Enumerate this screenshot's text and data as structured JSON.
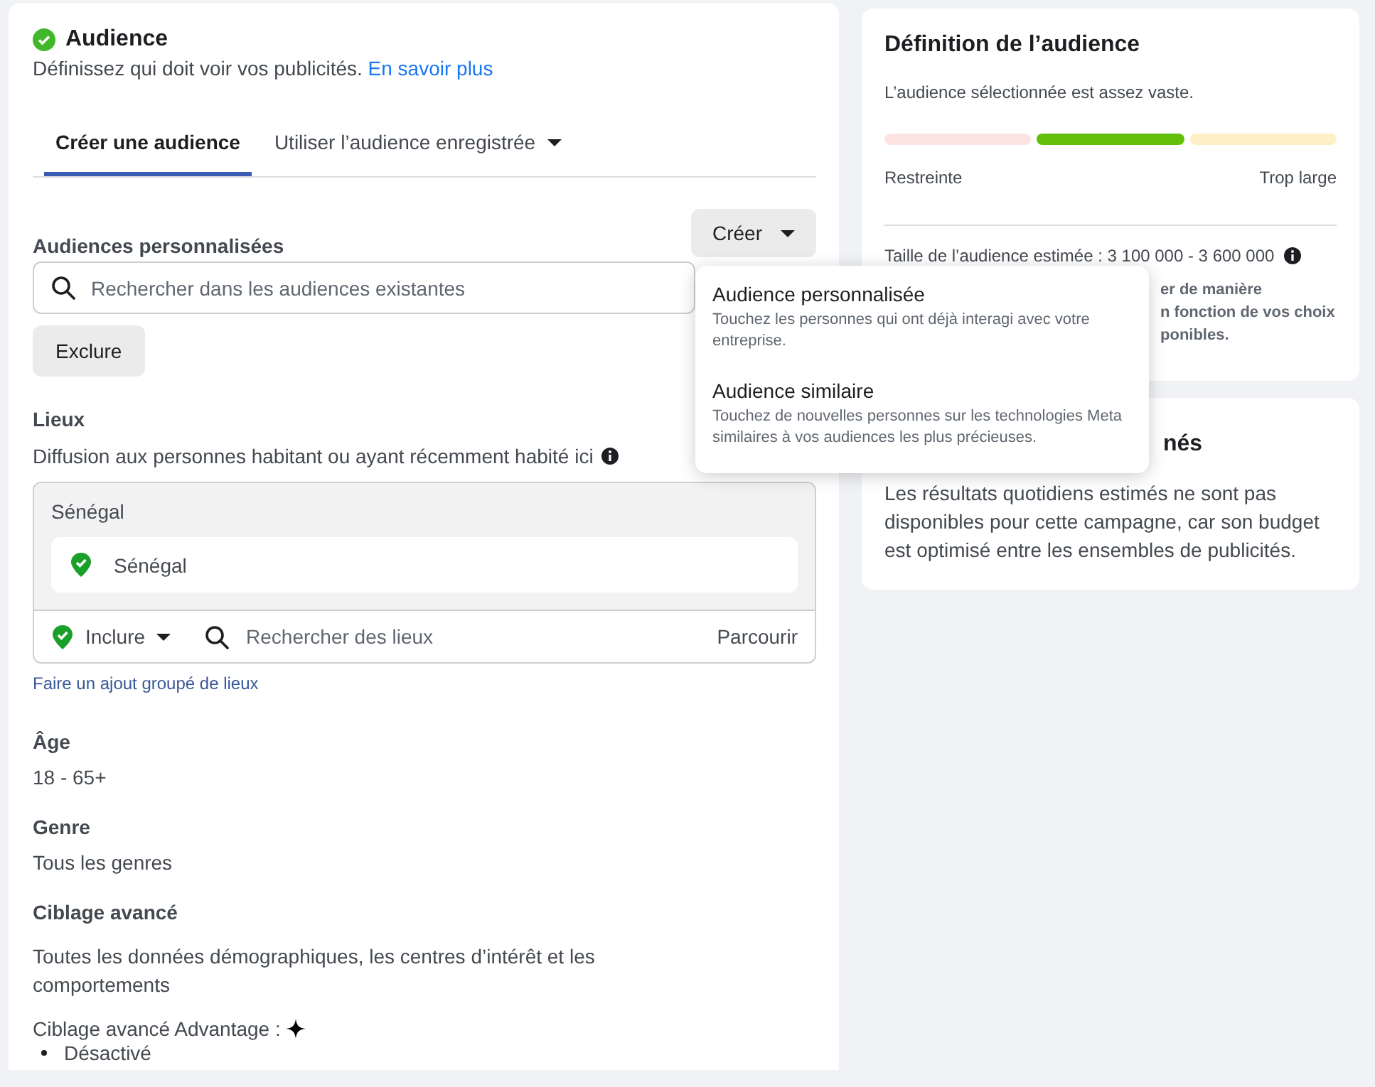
{
  "audience": {
    "title": "Audience",
    "complete": true,
    "description": "Définissez qui doit voir vos publicités.",
    "learn_more": "En savoir plus",
    "tabs": [
      {
        "label": "Créer une audience",
        "selected": true,
        "dropdown": false
      },
      {
        "label": "Utiliser l’audience enregistrée",
        "selected": false,
        "dropdown": true
      }
    ],
    "custom_audiences": {
      "label": "Audiences personnalisées",
      "create_button": "Créer",
      "search": {
        "placeholder": "Rechercher dans les audiences existantes"
      },
      "exclude_button": "Exclure"
    },
    "locations": {
      "label": "Lieux",
      "description": "Diffusion aux personnes habitant ou ayant récemment habité ici",
      "group": "Sénégal",
      "items": [
        "Sénégal"
      ],
      "mode": "Inclure",
      "search": {
        "placeholder": "Rechercher des lieux"
      },
      "browse": "Parcourir",
      "bulk_link": "Faire un ajout groupé de lieux"
    },
    "age": {
      "label": "Âge",
      "value": "18 - 65+"
    },
    "gender": {
      "label": "Genre",
      "value": "Tous les genres"
    },
    "detailed_targeting": {
      "label": "Ciblage avancé",
      "value": "Toutes les données démographiques, les centres d’intérêt et les comportements",
      "advantage_label": "Ciblage avancé Advantage :",
      "advantage_items": [
        "Désactivé"
      ]
    }
  },
  "create_menu": {
    "open": true,
    "items": [
      {
        "title": "Audience personnalisée",
        "description": "Touchez les personnes qui ont déjà interagi avec votre entreprise."
      },
      {
        "title": "Audience similaire",
        "description": "Touchez de nouvelles personnes sur les technologies Meta similaires à vos audiences les plus précieuses."
      }
    ]
  },
  "definition": {
    "title": "Définition de l’audience",
    "summary": "L’audience sélectionnée est assez vaste.",
    "segments": [
      {
        "color": "#fde3e1"
      },
      {
        "color": "#63be09"
      },
      {
        "color": "#fdefc8"
      }
    ],
    "min_label": "Restreinte",
    "max_label": "Trop large",
    "size": "Taille de l’audience estimée : 3 100 000 - 3 600 000",
    "note_lines": [
      "er de manière",
      "n fonction de vos choix",
      "ponibles."
    ]
  },
  "results": {
    "title": "nés",
    "text": "Les résultats quotidiens estimés ne sont pas disponibles pour cette campagne, car son budget est optimisé entre les ensembles de publicités."
  }
}
